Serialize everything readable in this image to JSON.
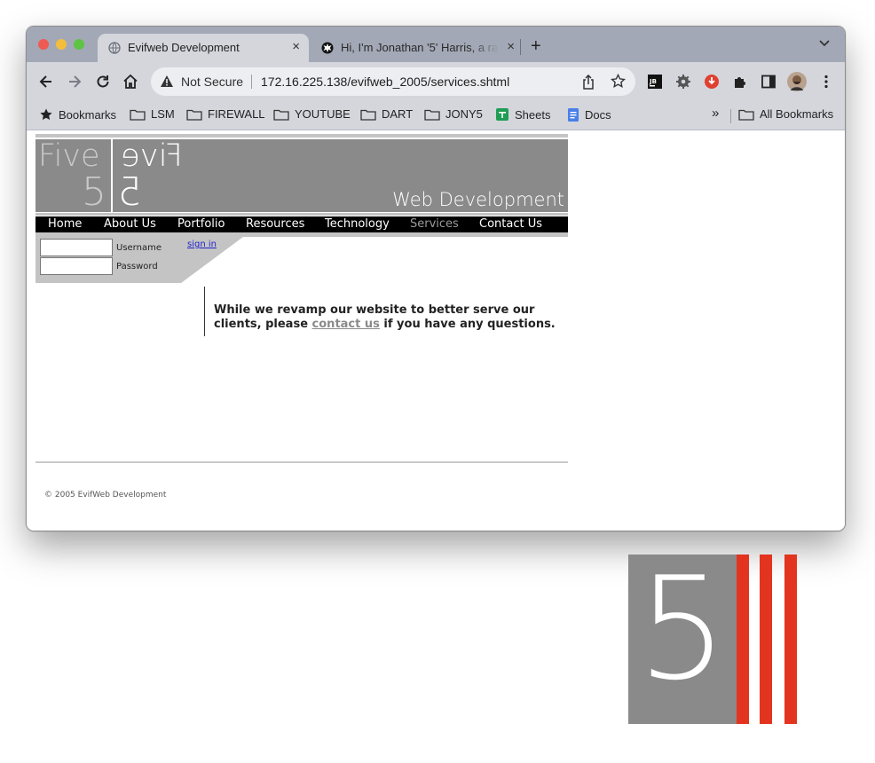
{
  "browser": {
    "tabs": [
      {
        "title": "Evifweb Development",
        "active": true
      },
      {
        "title": "Hi, I'm Jonathan '5' Harris, a ra",
        "active": false
      }
    ],
    "close_glyph": "×",
    "new_tab_glyph": "+",
    "security_label": "Not Secure",
    "url": "172.16.225.138/evifweb_2005/services.shtml",
    "bookmarks": [
      {
        "label": "Bookmarks",
        "icon": "star-icon"
      },
      {
        "label": "LSM",
        "icon": "folder-icon"
      },
      {
        "label": "FIREWALL",
        "icon": "folder-icon"
      },
      {
        "label": "YOUTUBE",
        "icon": "folder-icon"
      },
      {
        "label": "DART",
        "icon": "folder-icon"
      },
      {
        "label": "JONY5",
        "icon": "folder-icon"
      },
      {
        "label": "Sheets",
        "icon": "sheets-icon"
      },
      {
        "label": "Docs",
        "icon": "docs-icon"
      }
    ],
    "overflow_glyph": "»",
    "all_bookmarks": "All Bookmarks",
    "accent_colors": {
      "tab_strip": "#a3a8b6",
      "toolbar": "#d4d6dc"
    }
  },
  "site": {
    "logo_top": "Five",
    "logo_bottom": "5",
    "tagline": "Web Development",
    "nav": [
      "Home",
      "About Us",
      "Portfolio",
      "Resources",
      "Technology",
      "Services",
      "Contact Us"
    ],
    "current_nav": "Services",
    "login": {
      "username_label": "Username",
      "password_label": "Password",
      "signin_label": "sign in"
    },
    "message_before": "While we revamp our website to better serve our clients, please ",
    "message_link": "contact us",
    "message_after": " if you have any questions.",
    "copyright": "© 2005 EvifWeb Development",
    "colors": {
      "banner": "#8a8a8a",
      "navbar": "#000000",
      "link_gray": "#8a8a8a"
    }
  },
  "desktop_logo": {
    "digit": "5",
    "colors": {
      "box": "#8a8a8a",
      "bars": "#e2341f"
    }
  }
}
